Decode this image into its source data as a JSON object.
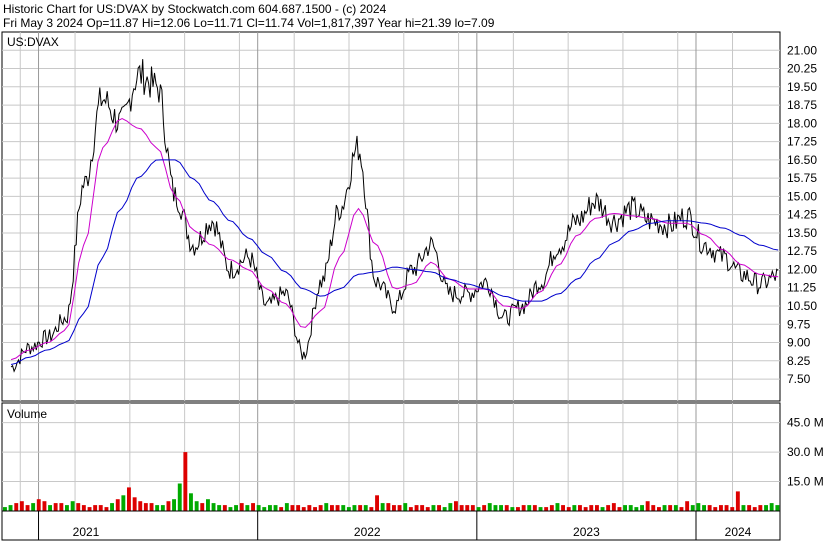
{
  "header": {
    "line1": "Historic Chart for US:DVAX by Stockwatch.com 604.687.1500 - (c) 2024",
    "line2": "Fri May  3 2024  Op=11.87  Hi=12.06  Lo=11.71  Cl=11.74  Vol=1,817,397  Year hi=21.39  lo=7.09"
  },
  "colors": {
    "price": "#000000",
    "ma_short": "#cc00cc",
    "ma_long": "#0000cc",
    "vol_down": "#dd0000",
    "vol_up": "#00aa00",
    "grid": "#c8c8c8"
  },
  "chart_data": [
    {
      "type": "line",
      "title": "US:DVAX",
      "xlabel": "",
      "ylabel": "",
      "x_ticks": [
        "2021",
        "2022",
        "2023",
        "2024"
      ],
      "y_ticks": [
        "7.50",
        "8.25",
        "9.00",
        "9.75",
        "10.50",
        "11.25",
        "12.00",
        "12.75",
        "13.50",
        "14.25",
        "15.00",
        "15.75",
        "16.50",
        "17.25",
        "18.00",
        "18.75",
        "19.50",
        "20.25",
        "21.00"
      ],
      "ylim": [
        6.6,
        21.75
      ],
      "grid": true,
      "x": [
        "2020-11",
        "2020-12",
        "2021-01",
        "2021-02",
        "2021-03",
        "2021-04",
        "2021-05",
        "2021-06",
        "2021-07",
        "2021-08",
        "2021-09",
        "2021-10",
        "2021-11",
        "2021-12",
        "2022-01",
        "2022-02",
        "2022-03",
        "2022-04",
        "2022-05",
        "2022-06",
        "2022-07",
        "2022-08",
        "2022-09",
        "2022-10",
        "2022-11",
        "2022-12",
        "2023-01",
        "2023-02",
        "2023-03",
        "2023-04",
        "2023-05",
        "2023-06",
        "2023-07",
        "2023-08",
        "2023-09",
        "2023-10",
        "2023-11",
        "2023-12",
        "2024-01",
        "2024-02",
        "2024-03",
        "2024-04",
        "2024-05"
      ],
      "series": [
        {
          "values": [
            8.0,
            8.8,
            9.2,
            10.0,
            15.5,
            19.0,
            18.0,
            20.0,
            19.5,
            15.0,
            13.0,
            14.0,
            12.0,
            12.5,
            10.5,
            11.0,
            8.5,
            11.5,
            14.5,
            17.0,
            11.5,
            10.5,
            12.0,
            13.0,
            11.0,
            11.0,
            11.5,
            10.0,
            10.5,
            11.5,
            13.0,
            14.0,
            14.8,
            14.0,
            14.5,
            14.0,
            13.8,
            14.2,
            13.0,
            12.5,
            11.8,
            11.4,
            11.74
          ]
        },
        {
          "values": [
            8.3,
            8.7,
            9.0,
            9.5,
            13.0,
            17.0,
            18.2,
            17.8,
            17.0,
            15.0,
            13.6,
            13.0,
            12.4,
            12.0,
            11.2,
            10.6,
            9.6,
            10.3,
            12.5,
            14.5,
            13.0,
            11.2,
            11.4,
            12.3,
            11.6,
            11.2,
            11.2,
            10.5,
            10.4,
            11.1,
            12.2,
            13.4,
            14.1,
            14.3,
            14.2,
            14.1,
            13.9,
            13.9,
            13.4,
            12.8,
            12.2,
            11.8,
            11.7
          ]
        },
        {
          "values": [
            8.1,
            8.4,
            8.7,
            9.0,
            10.2,
            12.5,
            14.5,
            15.8,
            16.5,
            16.5,
            15.7,
            14.8,
            14.0,
            13.3,
            12.6,
            11.9,
            11.2,
            10.9,
            11.2,
            11.8,
            11.9,
            12.1,
            12.0,
            11.9,
            11.6,
            11.4,
            11.2,
            10.9,
            10.7,
            10.7,
            11.0,
            11.6,
            12.4,
            13.1,
            13.6,
            13.9,
            14.0,
            14.0,
            13.9,
            13.7,
            13.4,
            13.0,
            12.8
          ]
        }
      ]
    },
    {
      "type": "bar",
      "title": "Volume",
      "x_ticks": [
        "2021",
        "2022",
        "2023",
        "2024"
      ],
      "y_ticks": [
        "15.0 M",
        "30.0 M",
        "45.0 M"
      ],
      "ylim": [
        0,
        55
      ],
      "values": [
        2,
        3,
        4,
        5,
        3,
        4,
        6,
        5,
        3,
        4,
        4,
        3,
        5,
        4,
        3,
        2,
        3,
        3,
        2,
        4,
        6,
        8,
        12,
        7,
        5,
        4,
        4,
        3,
        3,
        5,
        6,
        14,
        30,
        9,
        5,
        4,
        6,
        4,
        3,
        3,
        2,
        3,
        4,
        3,
        4,
        3,
        2,
        3,
        3,
        2,
        4,
        3,
        3,
        2,
        3,
        2,
        3,
        4,
        3,
        3,
        3,
        2,
        3,
        3,
        3,
        2,
        8,
        4,
        4,
        3,
        3,
        4,
        2,
        3,
        3,
        2,
        3,
        3,
        2,
        4,
        5,
        3,
        3,
        3,
        2,
        3,
        4,
        3,
        3,
        3,
        2,
        2,
        3,
        3,
        3,
        2,
        2,
        3,
        4,
        3,
        2,
        3,
        3,
        2,
        3,
        3,
        2,
        3,
        4,
        2,
        3,
        3,
        2,
        3,
        5,
        3,
        2,
        3,
        3,
        3,
        2,
        5,
        3,
        4,
        3,
        3,
        2,
        3,
        3,
        2,
        10,
        3,
        3,
        2,
        3,
        3,
        4,
        3
      ]
    }
  ]
}
